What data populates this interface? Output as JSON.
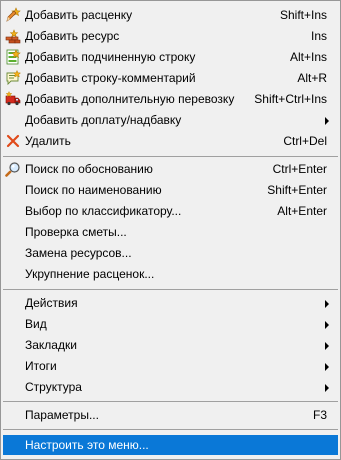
{
  "menu": {
    "items": [
      {
        "label": "Добавить расценку",
        "shortcut": "Shift+Ins"
      },
      {
        "label": "Добавить ресурс",
        "shortcut": "Ins"
      },
      {
        "label": "Добавить подчиненную строку",
        "shortcut": "Alt+Ins"
      },
      {
        "label": "Добавить строку-комментарий",
        "shortcut": "Alt+R"
      },
      {
        "label": "Добавить дополнительную перевозку",
        "shortcut": "Shift+Ctrl+Ins"
      },
      {
        "label": "Добавить доплату/надбавку"
      },
      {
        "label": "Удалить",
        "shortcut": "Ctrl+Del"
      },
      {
        "label": "Поиск по обоснованию",
        "shortcut": "Ctrl+Enter"
      },
      {
        "label": "Поиск по наименованию",
        "shortcut": "Shift+Enter"
      },
      {
        "label": "Выбор по классификатору...",
        "shortcut": "Alt+Enter"
      },
      {
        "label": "Проверка сметы..."
      },
      {
        "label": "Замена ресурсов..."
      },
      {
        "label": "Укрупнение расценок..."
      },
      {
        "label": "Действия"
      },
      {
        "label": "Вид"
      },
      {
        "label": "Закладки"
      },
      {
        "label": "Итоги"
      },
      {
        "label": "Структура"
      },
      {
        "label": "Параметры...",
        "shortcut": "F3"
      },
      {
        "label": "Настроить это меню..."
      }
    ]
  },
  "icons": {
    "add_rate": "pencil-star-icon",
    "add_resource": "bricks-icon",
    "add_subrow": "green-list-icon",
    "add_comment": "comment-bubble-icon",
    "add_transport": "red-truck-icon",
    "delete": "red-x-icon",
    "search": "magnifier-icon"
  },
  "colors": {
    "menu_background": "#f0f0f0",
    "highlight": "#0a78d7",
    "delete_icon": "#e04a1a"
  }
}
